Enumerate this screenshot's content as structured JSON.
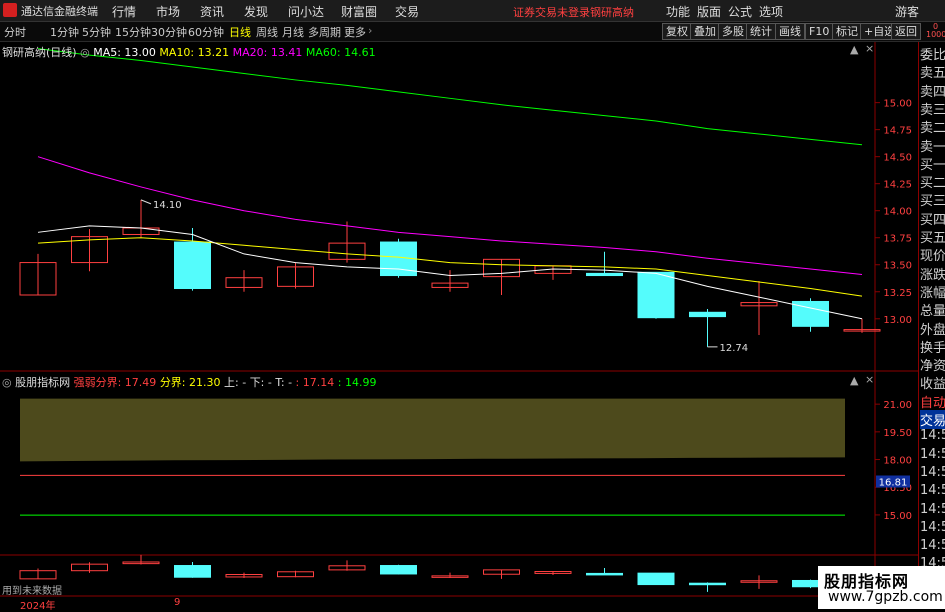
{
  "app": {
    "name": "通达信金融终端"
  },
  "menu": [
    "行情",
    "市场",
    "资讯",
    "发现",
    "问小达",
    "财富圈",
    "交易"
  ],
  "warning": {
    "text1": "证券交易未登录",
    "text2": "钢研高纳"
  },
  "right_menu": [
    "功能",
    "版面",
    "公式",
    "选项",
    "游客"
  ],
  "periods": [
    "分时",
    "1分钟",
    "5分钟",
    "15分钟",
    "30分钟",
    "60分钟",
    "日线",
    "周线",
    "月线",
    "多周期",
    "更多"
  ],
  "active_period": "日线",
  "right_tools": [
    "复权",
    "叠加",
    "多股",
    "统计",
    "画线",
    "F10",
    "标记",
    "+自选",
    "返回"
  ],
  "stamp": "0\n1000",
  "legend": {
    "stock": "钢研高纳(日线)",
    "ma5": "MA5: 13.00",
    "ma10": "MA10: 13.21",
    "ma20": "MA20: 13.41",
    "ma60": "MA60: 14.61"
  },
  "colors": {
    "ma5": "#ffffff",
    "ma10": "#ffff00",
    "ma20": "#ff00ff",
    "ma60": "#00ff00",
    "up": "#ff4040",
    "down": "#54fcfc",
    "area": "#4d4a1c"
  },
  "indicator_legend": {
    "name": "股朋指标网",
    "f1": "强弱分界: 17.49",
    "f2": "分界: 21.30",
    "f3": "上: -",
    "f4": "下: -",
    "f5": "T: -",
    "f6": ": 17.14",
    "f7": ": 14.99"
  },
  "right_panel": [
    "委比",
    "卖五",
    "卖四",
    "卖三",
    "卖二",
    "卖一",
    "买一",
    "买二",
    "买三",
    "买四",
    "买五",
    "现价",
    "涨跌",
    "涨幅",
    "总量",
    "外盘",
    "换手",
    "净资",
    "收益",
    "自动",
    "交易",
    "14:56",
    "14:56",
    "14:56",
    "14:56",
    "14:56",
    "14:56",
    "14:56",
    "14:56",
    "14:56"
  ],
  "footer": "用到未来数据",
  "xaxis": {
    "year": "2024年",
    "month": "9"
  },
  "watermark": {
    "line1": "股朋指标网",
    "line2": "www.7gpzb.com"
  },
  "chart_data": [
    {
      "type": "candlestick",
      "yticks": [
        15.0,
        14.75,
        14.5,
        14.25,
        14.0,
        13.75,
        13.5,
        13.25,
        13.0
      ],
      "ylim": [
        12.6,
        15.45
      ],
      "annotations": [
        {
          "text": "14.10",
          "value": 14.1,
          "index": 4
        },
        {
          "text": "12.74",
          "value": 12.74,
          "index": 26
        }
      ],
      "candles": [
        {
          "o": 13.22,
          "h": 13.6,
          "l": 13.22,
          "c": 13.52
        },
        {
          "o": 13.52,
          "h": 13.83,
          "l": 13.44,
          "c": 13.76
        },
        {
          "o": 13.78,
          "h": 14.1,
          "l": 13.75,
          "c": 13.84
        },
        {
          "o": 13.71,
          "h": 13.84,
          "l": 13.26,
          "c": 13.28
        },
        {
          "o": 13.29,
          "h": 13.45,
          "l": 13.25,
          "c": 13.38
        },
        {
          "o": 13.3,
          "h": 13.52,
          "l": 13.28,
          "c": 13.48
        },
        {
          "o": 13.55,
          "h": 13.9,
          "l": 13.52,
          "c": 13.7
        },
        {
          "o": 13.71,
          "h": 13.74,
          "l": 13.38,
          "c": 13.4
        },
        {
          "o": 13.29,
          "h": 13.45,
          "l": 13.25,
          "c": 13.33
        },
        {
          "o": 13.39,
          "h": 13.55,
          "l": 13.22,
          "c": 13.55
        },
        {
          "o": 13.42,
          "h": 13.49,
          "l": 13.36,
          "c": 13.49
        },
        {
          "o": 13.42,
          "h": 13.62,
          "l": 13.4,
          "c": 13.4
        },
        {
          "o": 13.43,
          "h": 13.43,
          "l": 13.0,
          "c": 13.01
        },
        {
          "o": 13.06,
          "h": 13.09,
          "l": 12.74,
          "c": 13.02
        },
        {
          "o": 13.12,
          "h": 13.35,
          "l": 12.85,
          "c": 13.15
        },
        {
          "o": 13.16,
          "h": 13.19,
          "l": 12.88,
          "c": 12.93
        },
        {
          "o": 12.89,
          "h": 13.0,
          "l": 12.87,
          "c": 12.9
        }
      ],
      "ma5": [
        13.8,
        13.86,
        13.84,
        13.78,
        13.6,
        13.52,
        13.48,
        13.46,
        13.4,
        13.42,
        13.46,
        13.45,
        13.42,
        13.3,
        13.2,
        13.1,
        13.0
      ],
      "ma10": [
        13.7,
        13.73,
        13.75,
        13.72,
        13.68,
        13.64,
        13.6,
        13.57,
        13.52,
        13.5,
        13.49,
        13.48,
        13.46,
        13.4,
        13.34,
        13.28,
        13.21
      ],
      "ma20": [
        14.5,
        14.35,
        14.22,
        14.1,
        14.0,
        13.92,
        13.86,
        13.8,
        13.76,
        13.72,
        13.69,
        13.66,
        13.62,
        13.56,
        13.51,
        13.46,
        13.41
      ],
      "ma60": [
        15.5,
        15.44,
        15.39,
        15.33,
        15.27,
        15.21,
        15.16,
        15.1,
        15.04,
        14.98,
        14.93,
        14.88,
        14.83,
        14.76,
        14.71,
        14.66,
        14.61
      ]
    },
    {
      "type": "area",
      "yticks": [
        21.0,
        19.5,
        18.0,
        16.5,
        15.0
      ],
      "ylim": [
        13.1,
        22.2
      ],
      "current_value": "16.81",
      "current_level": 16.81,
      "upper": [
        21.3,
        21.3,
        21.3,
        21.3,
        21.3,
        21.3,
        21.3,
        21.3,
        21.3,
        21.3,
        21.3,
        21.3,
        21.3,
        21.3,
        21.3,
        21.3,
        21.3
      ],
      "lower": [
        17.9,
        17.92,
        17.94,
        17.96,
        17.97,
        17.98,
        18.0,
        18.01,
        18.02,
        18.04,
        18.05,
        18.06,
        18.07,
        18.09,
        18.1,
        18.11,
        18.12
      ],
      "line_red": 17.14,
      "line_green": 14.99
    }
  ]
}
